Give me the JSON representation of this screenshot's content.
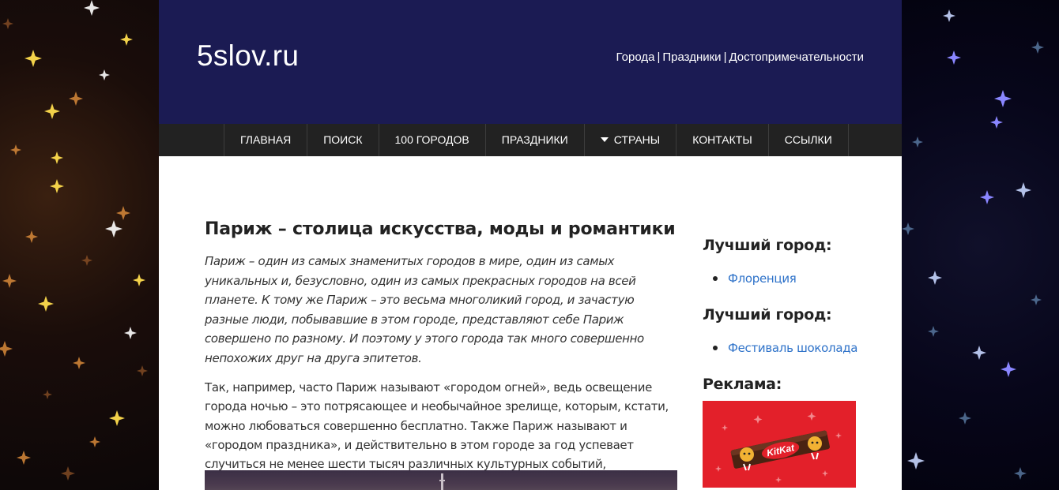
{
  "site": {
    "logo": "5slov.ru",
    "top_links": [
      "Города",
      "Праздники",
      "Достопримечательности"
    ],
    "top_link_separator": "|"
  },
  "nav": {
    "items": [
      {
        "label": "ГЛАВНАЯ"
      },
      {
        "label": "ПОИСК"
      },
      {
        "label": "100 ГОРОДОВ"
      },
      {
        "label": "ПРАЗДНИКИ"
      },
      {
        "label": "СТРАНЫ",
        "has_dropdown": true
      },
      {
        "label": "КОНТАКТЫ"
      },
      {
        "label": "ССЫЛКИ"
      }
    ]
  },
  "article": {
    "title": "Париж – столица искусства, моды и романтики",
    "lead": "Париж – один из самых знаменитых городов в мире, один из самых уникальных и, безусловно, один из самых прекрасных городов на всей планете. К тому же Париж – это весьма многоликий город, и зачастую разные люди, побывавшие в этом городе, представляют себе Париж совершено по разному. И поэтому у этого города так много совершенно непохожих друг на друга эпитетов.",
    "paragraph": "Так, например, часто Париж называют «городом огней», ведь освещение города ночью – это потрясающее и необычайное зрелище, которым, кстати, можно любоваться совершенно бесплатно. Также Париж называют и «городом праздника», и действительно в этом городе за год успевает случиться не менее шести тысяч различных культурных событий, праздников и фестивалей."
  },
  "sidebar": {
    "widget1": {
      "title": "Лучший город:",
      "link": "Флоренция"
    },
    "widget2": {
      "title": "Лучший город:",
      "link": "Фестиваль шоколада"
    },
    "widget3": {
      "title": "Реклама:",
      "ad_text": "KitKat"
    }
  },
  "colors": {
    "header_bg": "#1b1b53",
    "nav_bg": "#222222",
    "link": "#2e72c9",
    "ad_bg": "#e3202a"
  }
}
